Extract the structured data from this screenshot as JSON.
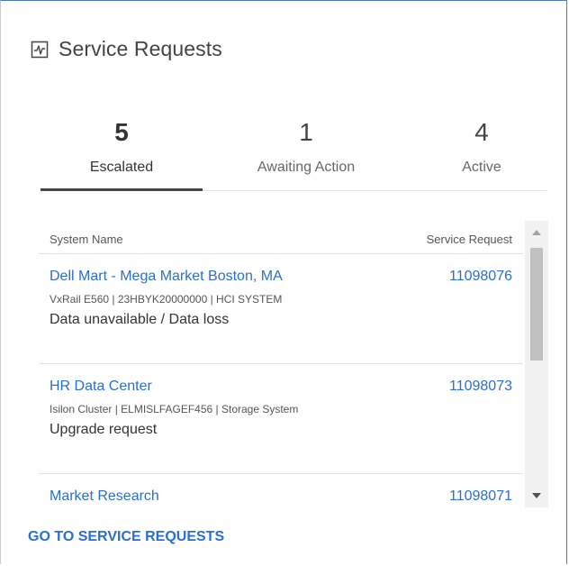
{
  "header": {
    "title": "Service Requests",
    "icon": "activity-chart-icon"
  },
  "tabs": [
    {
      "count": "5",
      "label": "Escalated",
      "active": true
    },
    {
      "count": "1",
      "label": "Awaiting Action",
      "active": false
    },
    {
      "count": "4",
      "label": "Active",
      "active": false
    }
  ],
  "table": {
    "columns": [
      "System Name",
      "Service Request"
    ],
    "rows": [
      {
        "name": "Dell Mart - Mega Market Boston, MA",
        "sr": "11098076",
        "meta": "VxRail E560 | 23HBYK20000000 | HCI SYSTEM",
        "desc": "Data unavailable / Data loss"
      },
      {
        "name": "HR Data Center",
        "sr": "11098073",
        "meta": "Isilon Cluster | ELMISLFAGEF456 | Storage System",
        "desc": "Upgrade request"
      },
      {
        "name": "Market Research",
        "sr": "11098071",
        "meta": "",
        "desc": ""
      }
    ]
  },
  "footer": {
    "link": "GO TO SERVICE REQUESTS"
  },
  "colors": {
    "link": "#2a6fcb",
    "accent_border": "#4a78c8"
  }
}
